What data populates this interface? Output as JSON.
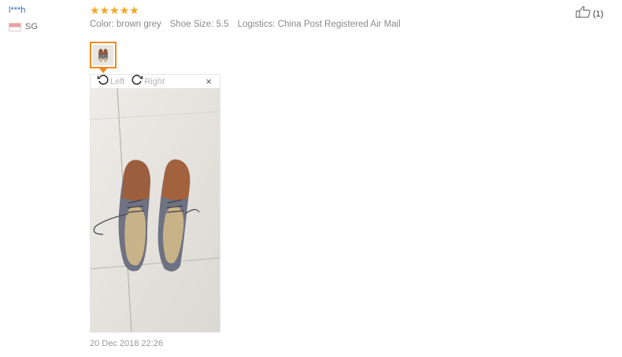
{
  "user": {
    "name": "l***h",
    "country_code": "SG"
  },
  "rating": {
    "stars": 5,
    "max": 5,
    "color": "#f5a623"
  },
  "attributes": {
    "color": "Color: brown grey",
    "shoe_size": "Shoe Size: 5.5",
    "logistics": "Logistics: China Post Registered Air Mail"
  },
  "helpful": {
    "count": "(1)",
    "icon": "thumbs-up-icon"
  },
  "viewer": {
    "rotate_left_label": "Left",
    "rotate_right_label": "Right",
    "close_label": "×",
    "accent_color": "#f08a24"
  },
  "review_date": "20 Dec 2018 22:26"
}
